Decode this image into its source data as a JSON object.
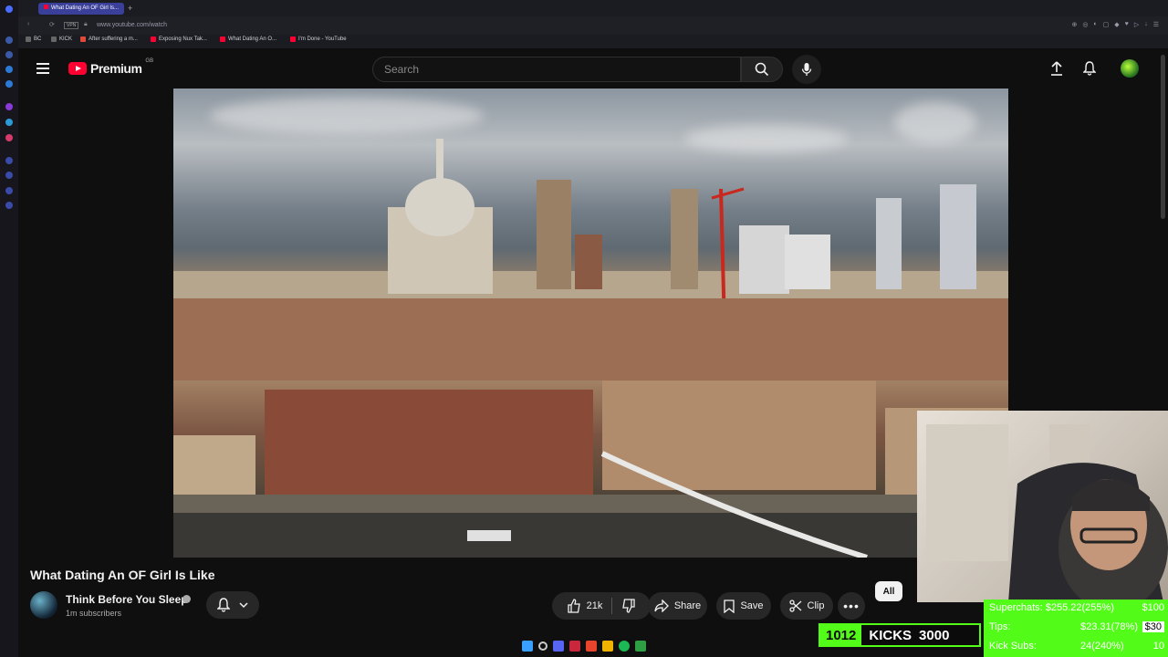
{
  "browser": {
    "active_tab": "What Dating An OF Girl Is...",
    "url": "www.youtube.com/watch",
    "bookmarks": [
      "BC",
      "KICK",
      "After suffering a m...",
      "Exposing Nux Tak...",
      "What Dating An O...",
      "I'm Done - YouTube"
    ]
  },
  "header": {
    "logo_text": "Premium",
    "region": "GB",
    "search_placeholder": "Search"
  },
  "video": {
    "title": "What Dating An OF Girl Is Like",
    "channel": "Think Before You Sleep",
    "subscribers": "1m subscribers",
    "likes": "21k",
    "share_label": "Share",
    "save_label": "Save",
    "clip_label": "Clip",
    "chip_all": "All"
  },
  "overlay": {
    "kicks_current": "1012",
    "kicks_label": "KICKS",
    "kicks_goal": "3000",
    "superchats": "Superchats: $255.22(255%)",
    "superchats_goal": "$100",
    "tips_label": "Tips:",
    "tips_value": "$23.31(78%)",
    "tips_goal": "$30",
    "kick_subs_label": "Kick Subs:",
    "kick_subs_value": "24(240%)",
    "kick_subs_goal": "10"
  },
  "colors": {
    "yt_red": "#ff0033",
    "kick_green": "#53fc18",
    "bg": "#0f0f0f"
  }
}
